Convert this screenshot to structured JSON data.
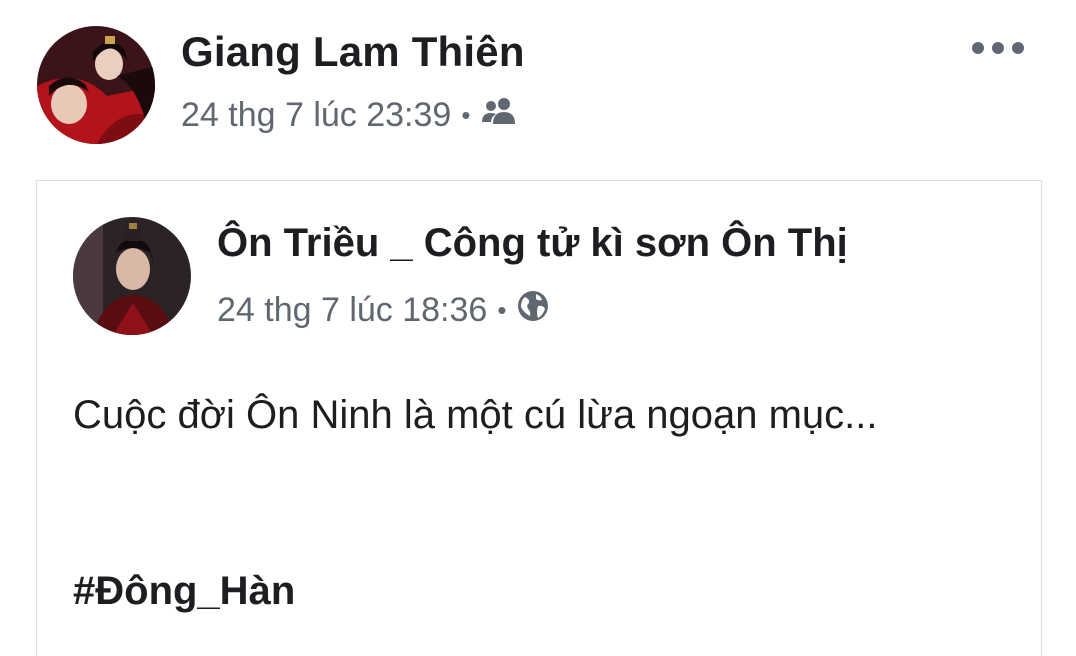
{
  "post": {
    "author_name": "Giang Lam Thiên",
    "timestamp": "24 thg 7 lúc 23:39",
    "separator": "•",
    "audience_icon": "friends-icon",
    "more_icon": "more-horizontal-icon"
  },
  "shared_post": {
    "author_name": "Ôn Triều _ Công tử kì sơn Ôn Thị",
    "timestamp": "24 thg 7 lúc 18:36",
    "separator": "•",
    "audience_icon": "globe-icon",
    "text": "Cuộc đời Ôn Ninh là một cú lừa ngoạn mục...",
    "hashtag": "#Đông_Hàn"
  },
  "colors": {
    "primary_text": "#1c1e21",
    "secondary_text": "#606770",
    "border": "#dadde1"
  }
}
